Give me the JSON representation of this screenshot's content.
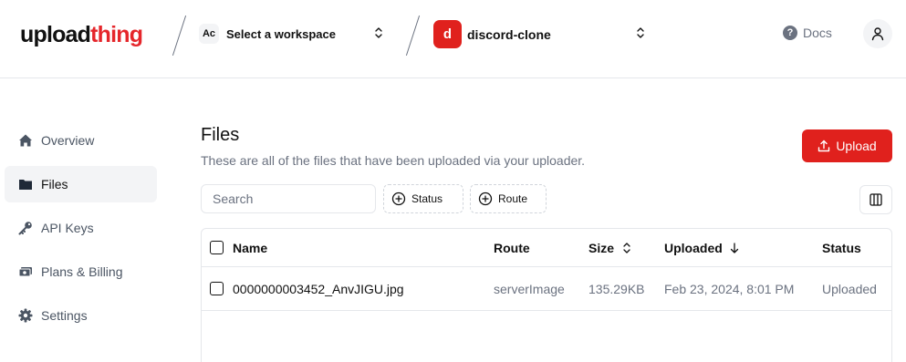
{
  "header": {
    "logo_main": "upload",
    "logo_accent": "thing",
    "workspace_initials": "Ac",
    "workspace_label": "Select a workspace",
    "project_initial": "d",
    "project_name": "discord-clone",
    "docs_label": "Docs",
    "docs_icon": "question-circle-icon",
    "user_icon": "user-icon"
  },
  "sidebar": {
    "items": [
      {
        "label": "Overview",
        "icon": "home-icon",
        "active": false
      },
      {
        "label": "Files",
        "icon": "folder-icon",
        "active": true
      },
      {
        "label": "API Keys",
        "icon": "key-icon",
        "active": false
      },
      {
        "label": "Plans & Billing",
        "icon": "billing-icon",
        "active": false
      },
      {
        "label": "Settings",
        "icon": "gear-icon",
        "active": false
      }
    ]
  },
  "main": {
    "title": "Files",
    "subtitle": "These are all of the files that have been uploaded via your uploader.",
    "upload_label": "Upload",
    "search_placeholder": "Search",
    "filter_status": "Status",
    "filter_route": "Route"
  },
  "table": {
    "columns": [
      "Name",
      "Route",
      "Size",
      "Uploaded",
      "Status"
    ],
    "rows": [
      {
        "name": "0000000003452_AnvJIGU.jpg",
        "route": "serverImage",
        "size": "135.29KB",
        "uploaded": "Feb 23, 2024, 8:01 PM",
        "status": "Uploaded"
      }
    ]
  },
  "colors": {
    "brand_red": "#e0211d",
    "text_muted": "#6b7280",
    "border": "#e5e7eb"
  }
}
